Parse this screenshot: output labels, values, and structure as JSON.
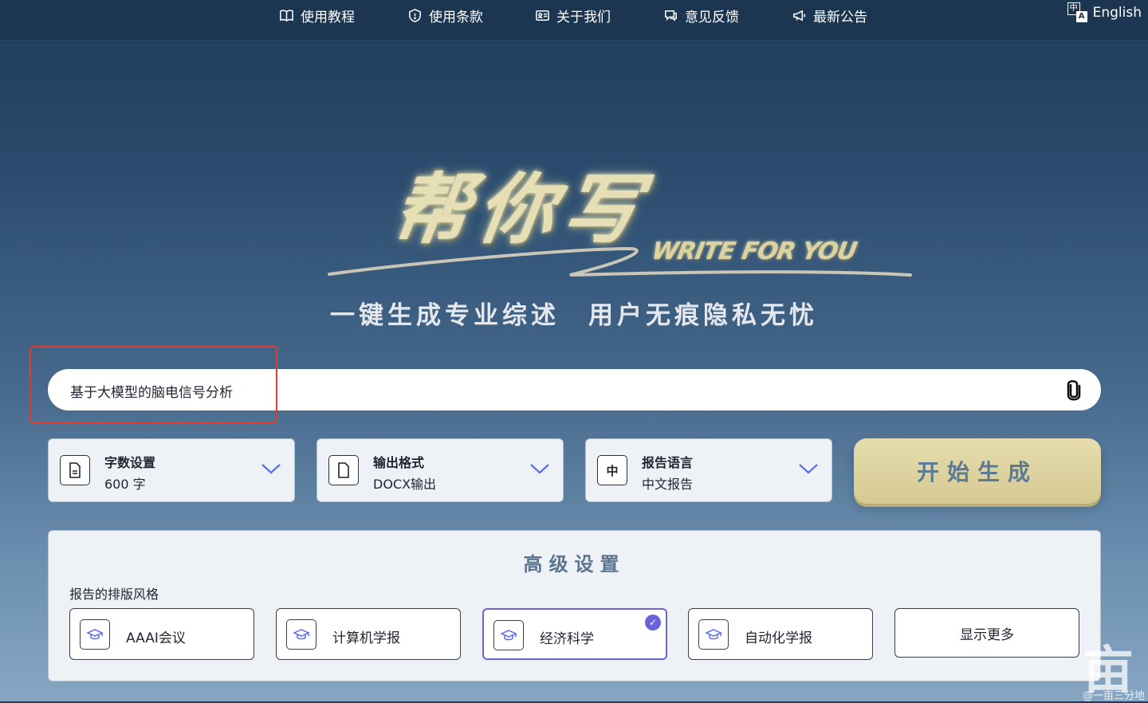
{
  "nav": {
    "items": [
      {
        "label": "使用教程",
        "icon": "book-icon"
      },
      {
        "label": "使用条款",
        "icon": "shield-icon"
      },
      {
        "label": "关于我们",
        "icon": "id-card-icon"
      },
      {
        "label": "意见反馈",
        "icon": "chat-icon"
      },
      {
        "label": "最新公告",
        "icon": "megaphone-icon"
      }
    ],
    "language": {
      "label": "English",
      "icon_glyph_a": "中",
      "icon_glyph_b": "A"
    }
  },
  "hero": {
    "logo_title": "帮你写",
    "logo_subtitle": "WRITE FOR YOU",
    "tagline_left": "一键生成专业综述",
    "tagline_right": "用户无痕隐私无忧"
  },
  "search": {
    "value": "基于大模型的脑电信号分析",
    "attach_icon": "paperclip-icon"
  },
  "options": [
    {
      "label": "字数设置",
      "value": "600 字",
      "icon": "document-lines-icon"
    },
    {
      "label": "输出格式",
      "value": "DOCX输出",
      "icon": "document-icon"
    },
    {
      "label": "报告语言",
      "value": "中文报告",
      "icon_text": "中"
    }
  ],
  "generate_button": {
    "label": "开始生成"
  },
  "advanced": {
    "title": "高级设置",
    "layout_style_label": "报告的排版风格",
    "styles": [
      {
        "label": "AAAI会议",
        "selected": false
      },
      {
        "label": "计算机学报",
        "selected": false
      },
      {
        "label": "经济科学",
        "selected": true
      },
      {
        "label": "自动化学报",
        "selected": false
      }
    ],
    "show_more_label": "显示更多",
    "check_glyph": "✓"
  },
  "watermark": {
    "glyph": "亩",
    "text": "@一亩三分地"
  },
  "colors": {
    "accent_purple": "#6b63d9",
    "button_gold": "#e0d5a2",
    "highlight_red": "#e23a2e",
    "nav_bg": "#1c3550"
  }
}
